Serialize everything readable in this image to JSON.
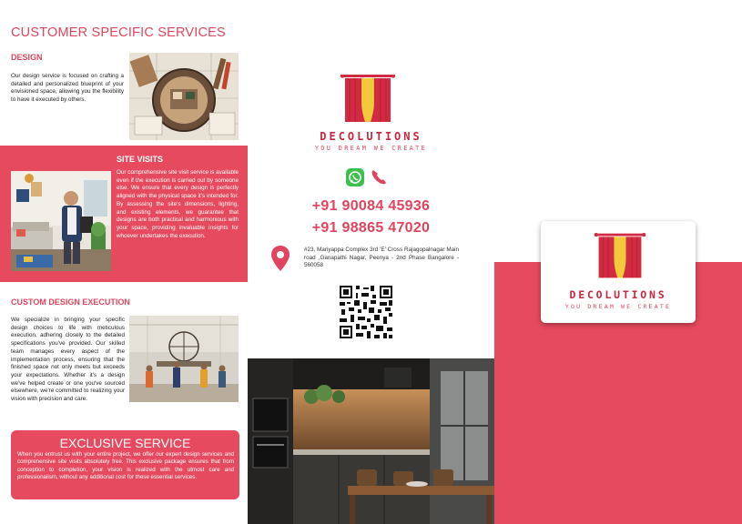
{
  "brand": {
    "name": "DECOLUTIONS",
    "tagline": "YOU DREAM WE CREATE",
    "accent_color": "#e64a5e",
    "logo_red": "#d22a42",
    "logo_yellow": "#f2c93a"
  },
  "left_panel": {
    "heading": "CUSTOMER SPECIFIC SERVICES",
    "design": {
      "title": "DESIGN",
      "text": "Our design service is focused on crafting a detailed and personalized blueprint of your envisioned space, allowing you the flexibility to have it executed by others."
    },
    "site_visits": {
      "title": "SITE VISITS",
      "text": "Our comprehensive site visit service is available even if the execution is carried out by someone else. We ensure that every design is perfectly aligned with the physical space it's intended for. By assessing the site's dimensions, lighting, and existing elements, we guarantee that designs are both practical and harmonious with your space, providing invaluable insights for whoever undertakes the execution."
    },
    "custom_execution": {
      "title": "CUSTOM DESIGN EXECUTION",
      "text": "We specialize in bringing your specific design choices to life with meticulous execution, adhering closely to the detailed specifications you've provided. Our skilled team manages every aspect of the implementation process, ensuring that the finished space not only meets but exceeds your expectations. Whether it's a design we've helped create or one you've sourced elsewhere, we're committed to realizing your vision with precision and care."
    },
    "exclusive": {
      "title": "EXCLUSIVE SERVICE",
      "text": "When you entrust us with your entire project, we offer our expert design services and comprehensive site visits absolutely free. This exclusive package ensures that from conception to completion, your vision is realized with the utmost care and professionalism, without any additional cost for these essential services."
    }
  },
  "middle_panel": {
    "icons": [
      "whatsapp-icon",
      "phone-icon",
      "location-pin-icon",
      "qr-code-icon"
    ],
    "phones": [
      "+91 90084 45936",
      "+91 98865 47020"
    ],
    "address": "#23, Mariyappa Complex 3rd 'E' Cross Rajagopalnagar Main road ,Ganapathi Nagar, Peenya - 2nd Phase Bangalore - 560058"
  }
}
